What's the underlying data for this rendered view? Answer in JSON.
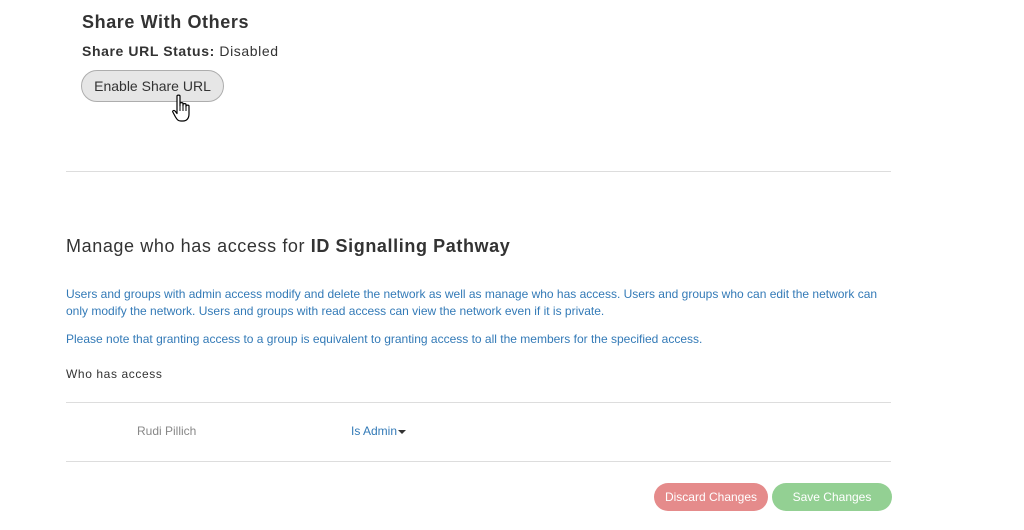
{
  "share": {
    "title": "Share With Others",
    "status_label": "Share URL Status:",
    "status_value": "Disabled",
    "enable_button": "Enable Share URL"
  },
  "manage": {
    "title_prefix": "Manage who has access for",
    "network_name": "ID Signalling Pathway",
    "info_1": "Users and groups with admin access modify and delete the network as well as manage who has access. Users and groups who can edit the network can only modify the network. Users and groups with read access can view the network even if it is private.",
    "info_2": "Please note that granting access to a group is equivalent to granting access to all the members for the specified access.",
    "who_label": "Who has access"
  },
  "access_list": [
    {
      "name": "Rudi Pillich",
      "role": "Is Admin"
    }
  ],
  "actions": {
    "discard": "Discard Changes",
    "save": "Save Changes"
  },
  "colors": {
    "link": "#337ab7",
    "discard": "#e58b8b",
    "save": "#93d093"
  },
  "icons": {
    "cursor": "hand-pointer-icon",
    "dropdown": "caret-down-icon"
  }
}
